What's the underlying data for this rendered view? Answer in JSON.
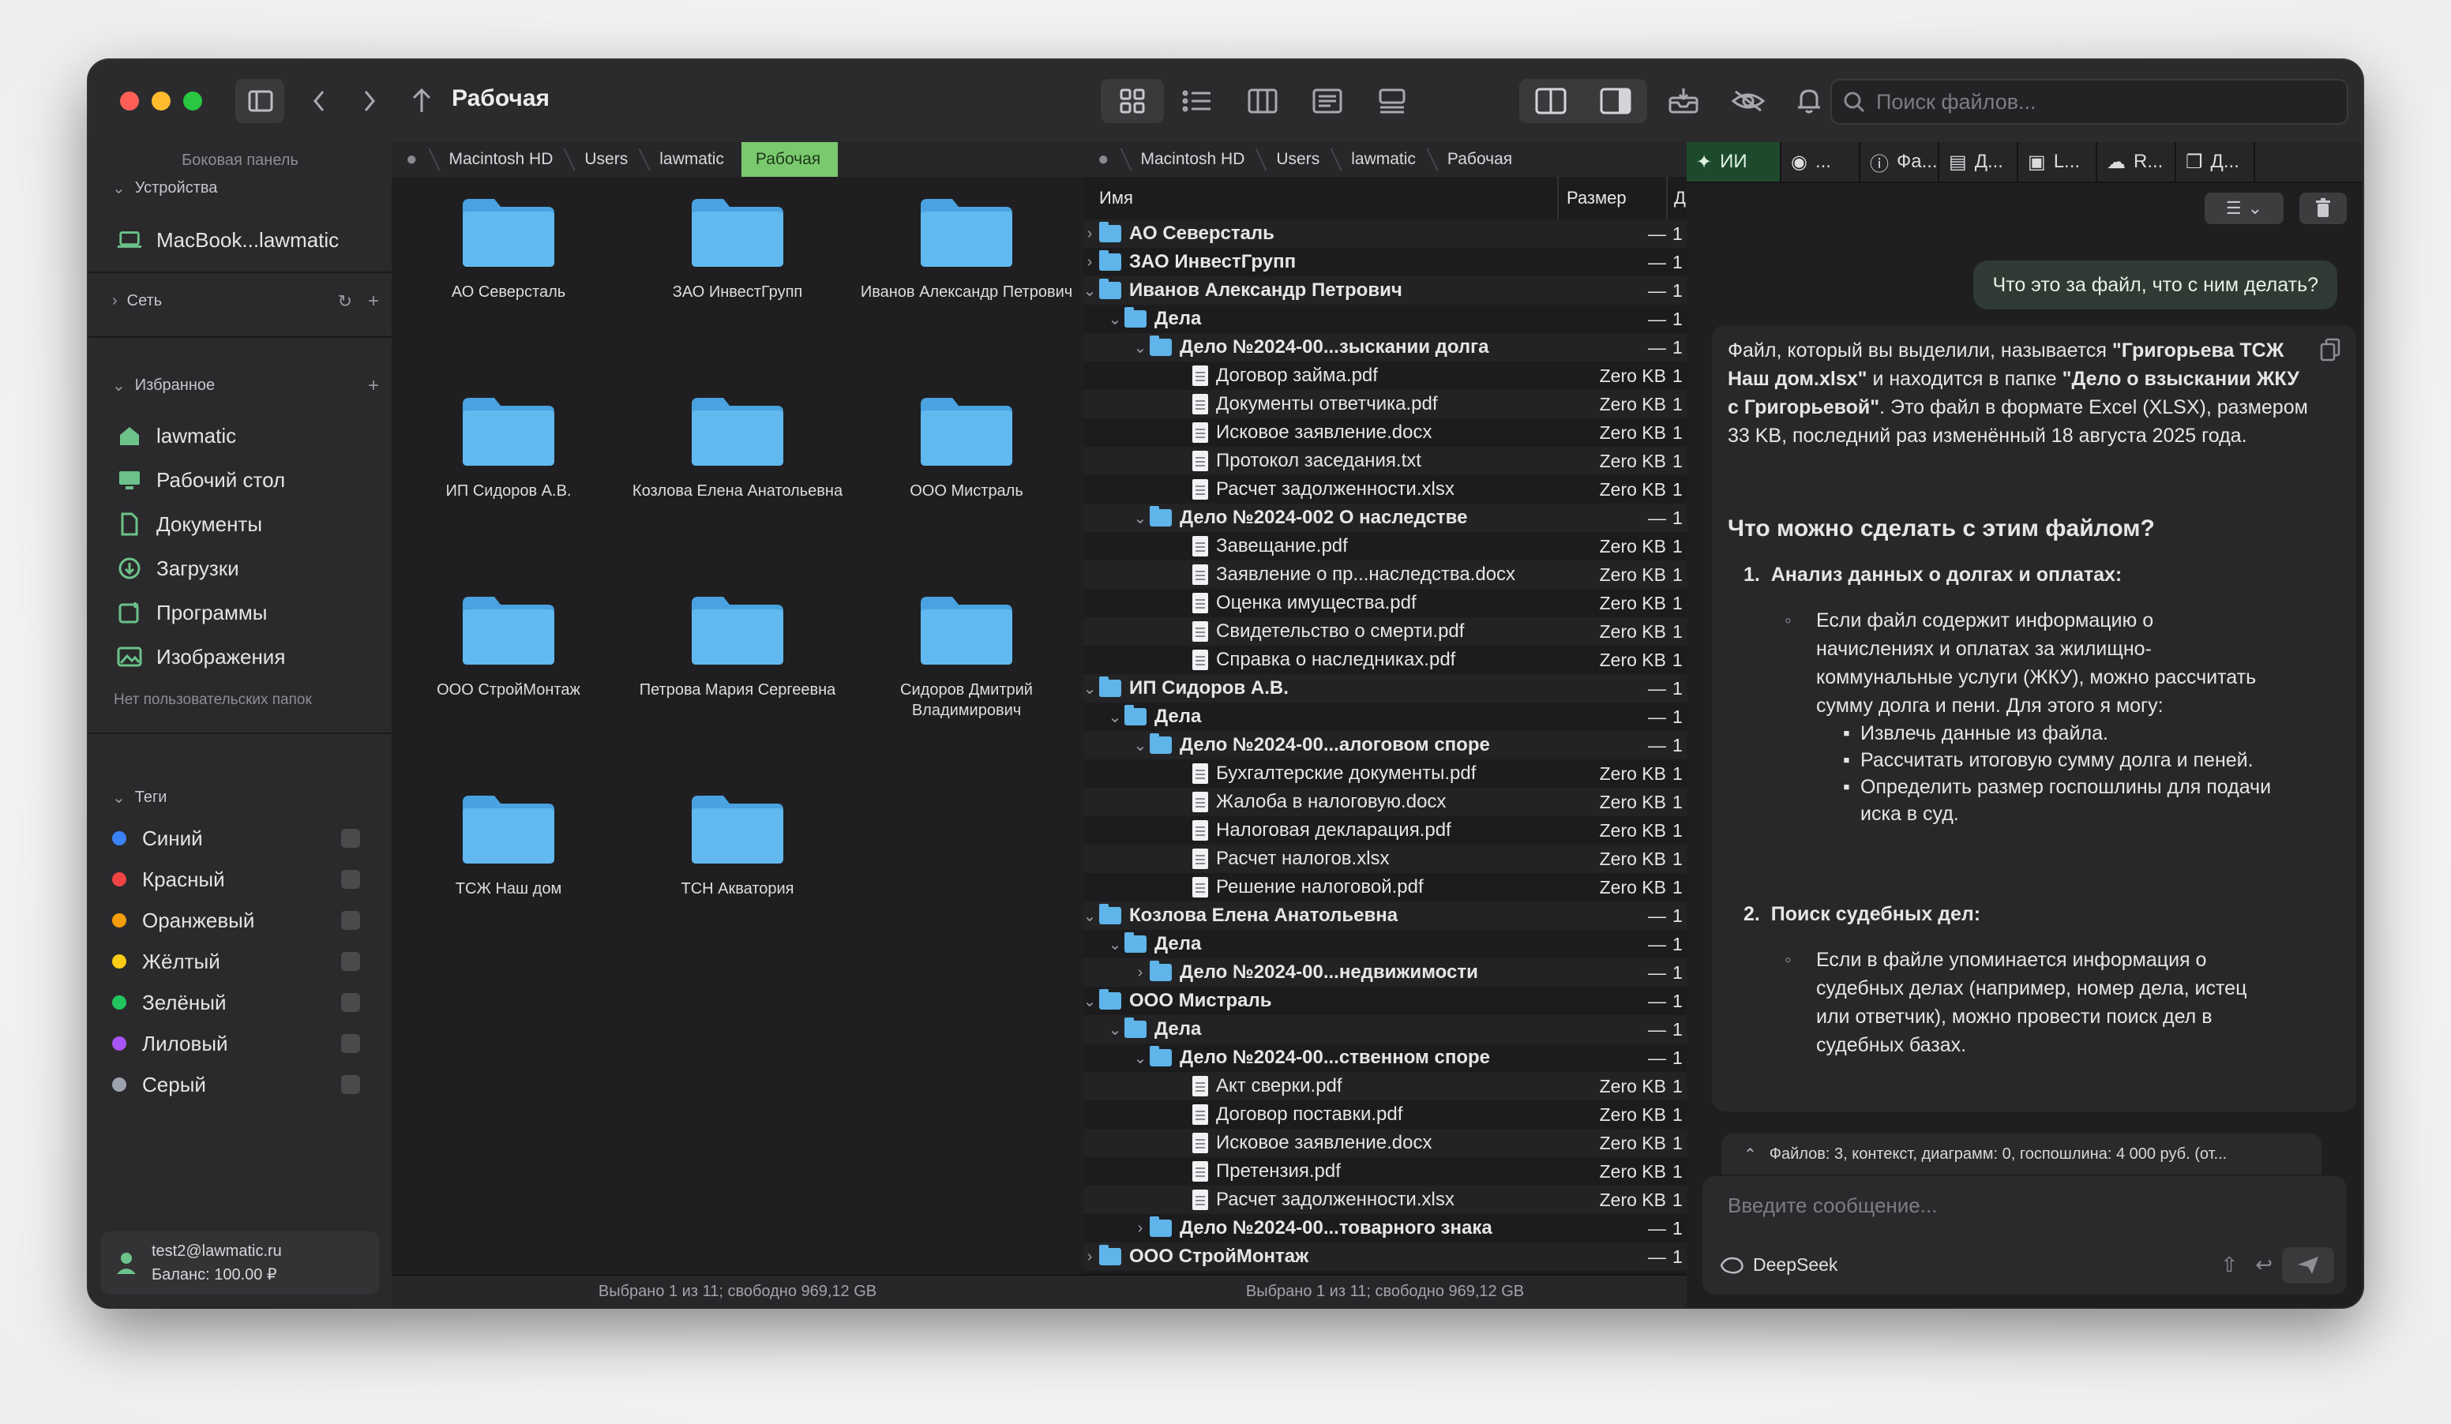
{
  "toolbar": {
    "title": "Рабочая",
    "search_placeholder": "Поиск файлов..."
  },
  "sidebar": {
    "caption": "Боковая панель",
    "devices_label": "Устройства",
    "device_name": "MacBook...lawmatic",
    "network_label": "Сеть",
    "favorites_label": "Избранное",
    "favorites": [
      {
        "label": "lawmatic",
        "icon": "home-icon"
      },
      {
        "label": "Рабочий стол",
        "icon": "desktop-icon"
      },
      {
        "label": "Документы",
        "icon": "document-icon"
      },
      {
        "label": "Загрузки",
        "icon": "download-icon"
      },
      {
        "label": "Программы",
        "icon": "apps-icon"
      },
      {
        "label": "Изображения",
        "icon": "image-icon"
      }
    ],
    "no_custom_folders": "Нет пользовательских папок",
    "tags_label": "Теги",
    "tags": [
      {
        "label": "Синий",
        "color": "#3b82f6"
      },
      {
        "label": "Красный",
        "color": "#ef4444"
      },
      {
        "label": "Оранжевый",
        "color": "#f59e0b"
      },
      {
        "label": "Жёлтый",
        "color": "#facc15"
      },
      {
        "label": "Зелёный",
        "color": "#22c55e"
      },
      {
        "label": "Лиловый",
        "color": "#a855f7"
      },
      {
        "label": "Серый",
        "color": "#9ca3af"
      }
    ],
    "user_email": "test2@lawmatic.ru",
    "user_balance": "Баланс: 100.00 ₽"
  },
  "breadcrumbs": [
    "Macintosh HD",
    "Users",
    "lawmatic",
    "Рабочая"
  ],
  "icon_view": {
    "folders": [
      "АО Северсталь",
      "ЗАО ИнвестГрупп",
      "Иванов Александр Петрович",
      "ИП Сидоров А.В.",
      "Козлова Елена Анатольевна",
      "ООО Мистраль",
      "ООО СтройМонтаж",
      "Петрова Мария Сергеевна",
      "Сидоров Дмитрий Владимирович",
      "ТСЖ Наш дом",
      "ТСН Акватория"
    ],
    "status": "Выбрано 1 из 11; свободно 969,12 GB"
  },
  "list_view": {
    "col_name": "Имя",
    "col_size": "Размер",
    "col_extra": "Д",
    "status": "Выбрано 1 из 11; свободно 969,12 GB",
    "rows": [
      {
        "level": 0,
        "type": "folder",
        "disc": "›",
        "name": "АО Северсталь",
        "size": "—",
        "extra": "1",
        "bold": true
      },
      {
        "level": 0,
        "type": "folder",
        "disc": "›",
        "name": "ЗАО ИнвестГрупп",
        "size": "—",
        "extra": "1",
        "bold": true
      },
      {
        "level": 0,
        "type": "folder",
        "disc": "⌄",
        "name": "Иванов Александр Петрович",
        "size": "—",
        "extra": "1",
        "bold": true
      },
      {
        "level": 1,
        "type": "folder",
        "disc": "⌄",
        "name": "Дела",
        "size": "—",
        "extra": "1",
        "bold": true
      },
      {
        "level": 2,
        "type": "folder",
        "disc": "⌄",
        "name": "Дело №2024-00...зыскании долга",
        "size": "—",
        "extra": "1",
        "bold": true
      },
      {
        "level": 3,
        "type": "file",
        "disc": "",
        "name": "Договор займа.pdf",
        "size": "Zero KB",
        "extra": "1",
        "bold": false
      },
      {
        "level": 3,
        "type": "file",
        "disc": "",
        "name": "Документы ответчика.pdf",
        "size": "Zero KB",
        "extra": "1",
        "bold": false
      },
      {
        "level": 3,
        "type": "file",
        "disc": "",
        "name": "Исковое заявление.docx",
        "size": "Zero KB",
        "extra": "1",
        "bold": false
      },
      {
        "level": 3,
        "type": "file",
        "disc": "",
        "name": "Протокол заседания.txt",
        "size": "Zero KB",
        "extra": "1",
        "bold": false
      },
      {
        "level": 3,
        "type": "file",
        "disc": "",
        "name": "Расчет задолженности.xlsx",
        "size": "Zero KB",
        "extra": "1",
        "bold": false
      },
      {
        "level": 2,
        "type": "folder",
        "disc": "⌄",
        "name": "Дело №2024-002 О наследстве",
        "size": "—",
        "extra": "1",
        "bold": true
      },
      {
        "level": 3,
        "type": "file",
        "disc": "",
        "name": "Завещание.pdf",
        "size": "Zero KB",
        "extra": "1",
        "bold": false
      },
      {
        "level": 3,
        "type": "file",
        "disc": "",
        "name": "Заявление о пр...наследства.docx",
        "size": "Zero KB",
        "extra": "1",
        "bold": false
      },
      {
        "level": 3,
        "type": "file",
        "disc": "",
        "name": "Оценка имущества.pdf",
        "size": "Zero KB",
        "extra": "1",
        "bold": false
      },
      {
        "level": 3,
        "type": "file",
        "disc": "",
        "name": "Свидетельство о смерти.pdf",
        "size": "Zero KB",
        "extra": "1",
        "bold": false
      },
      {
        "level": 3,
        "type": "file",
        "disc": "",
        "name": "Справка о наследниках.pdf",
        "size": "Zero KB",
        "extra": "1",
        "bold": false
      },
      {
        "level": 0,
        "type": "folder",
        "disc": "⌄",
        "name": "ИП Сидоров А.В.",
        "size": "—",
        "extra": "1",
        "bold": true
      },
      {
        "level": 1,
        "type": "folder",
        "disc": "⌄",
        "name": "Дела",
        "size": "—",
        "extra": "1",
        "bold": true
      },
      {
        "level": 2,
        "type": "folder",
        "disc": "⌄",
        "name": "Дело №2024-00...алоговом споре",
        "size": "—",
        "extra": "1",
        "bold": true
      },
      {
        "level": 3,
        "type": "file",
        "disc": "",
        "name": "Бухгалтерские документы.pdf",
        "size": "Zero KB",
        "extra": "1",
        "bold": false
      },
      {
        "level": 3,
        "type": "file",
        "disc": "",
        "name": "Жалоба в налоговую.docx",
        "size": "Zero KB",
        "extra": "1",
        "bold": false
      },
      {
        "level": 3,
        "type": "file",
        "disc": "",
        "name": "Налоговая декларация.pdf",
        "size": "Zero KB",
        "extra": "1",
        "bold": false
      },
      {
        "level": 3,
        "type": "file",
        "disc": "",
        "name": "Расчет налогов.xlsx",
        "size": "Zero KB",
        "extra": "1",
        "bold": false
      },
      {
        "level": 3,
        "type": "file",
        "disc": "",
        "name": "Решение налоговой.pdf",
        "size": "Zero KB",
        "extra": "1",
        "bold": false
      },
      {
        "level": 0,
        "type": "folder",
        "disc": "⌄",
        "name": "Козлова Елена Анатольевна",
        "size": "—",
        "extra": "1",
        "bold": true
      },
      {
        "level": 1,
        "type": "folder",
        "disc": "⌄",
        "name": "Дела",
        "size": "—",
        "extra": "1",
        "bold": true
      },
      {
        "level": 2,
        "type": "folder",
        "disc": "›",
        "name": "Дело №2024-00...недвижимости",
        "size": "—",
        "extra": "1",
        "bold": true
      },
      {
        "level": 0,
        "type": "folder",
        "disc": "⌄",
        "name": "ООО Мистраль",
        "size": "—",
        "extra": "1",
        "bold": true
      },
      {
        "level": 1,
        "type": "folder",
        "disc": "⌄",
        "name": "Дела",
        "size": "—",
        "extra": "1",
        "bold": true
      },
      {
        "level": 2,
        "type": "folder",
        "disc": "⌄",
        "name": "Дело №2024-00...ственном споре",
        "size": "—",
        "extra": "1",
        "bold": true
      },
      {
        "level": 3,
        "type": "file",
        "disc": "",
        "name": "Акт сверки.pdf",
        "size": "Zero KB",
        "extra": "1",
        "bold": false
      },
      {
        "level": 3,
        "type": "file",
        "disc": "",
        "name": "Договор поставки.pdf",
        "size": "Zero KB",
        "extra": "1",
        "bold": false
      },
      {
        "level": 3,
        "type": "file",
        "disc": "",
        "name": "Исковое заявление.docx",
        "size": "Zero KB",
        "extra": "1",
        "bold": false
      },
      {
        "level": 3,
        "type": "file",
        "disc": "",
        "name": "Претензия.pdf",
        "size": "Zero KB",
        "extra": "1",
        "bold": false
      },
      {
        "level": 3,
        "type": "file",
        "disc": "",
        "name": "Расчет задолженности.xlsx",
        "size": "Zero KB",
        "extra": "1",
        "bold": false
      },
      {
        "level": 2,
        "type": "folder",
        "disc": "›",
        "name": "Дело №2024-00...товарного знака",
        "size": "—",
        "extra": "1",
        "bold": true
      },
      {
        "level": 0,
        "type": "folder",
        "disc": "›",
        "name": "ООО СтройМонтаж",
        "size": "—",
        "extra": "1",
        "bold": true
      }
    ]
  },
  "ai_panel": {
    "tabs": [
      {
        "label": "ИИ",
        "icon": "magic-wand-icon"
      },
      {
        "label": "...",
        "icon": "eye-icon"
      },
      {
        "label": "Фа...",
        "icon": "info-icon"
      },
      {
        "label": "Д...",
        "icon": "doc-icon"
      },
      {
        "label": "L...",
        "icon": "card-icon"
      },
      {
        "label": "R...",
        "icon": "brain-icon"
      },
      {
        "label": "Д...",
        "icon": "copy-doc-icon"
      }
    ],
    "user_message": "Что это за файл, что с ним делать?",
    "answer": {
      "intro_1": "Файл, который вы выделили, называется ",
      "intro_file": "\"Григорьева ТСЖ Наш дом.xlsx\"",
      "intro_2": " и находится в папке ",
      "intro_folder": "\"Дело о взыскании ЖКУ с Григорьевой\"",
      "intro_3": ". Это файл в формате Excel (XLSX), размером 33 KB, последний раз изменённый 18 августа 2025 года.",
      "heading": "Что можно сделать с этим файлом?",
      "item1_title": "Анализ данных о долгах и оплатах:",
      "item1_text": "Если файл содержит информацию о начислениях и оплатах за жилищно-коммунальные услуги (ЖКУ), можно рассчитать сумму долга и пени. Для этого я могу:",
      "item1_bullets": [
        "Извлечь данные из файла.",
        "Рассчитать итоговую сумму долга и пеней.",
        "Определить размер госпошлины для подачи иска в суд."
      ],
      "item2_title": "Поиск судебных дел:",
      "item2_text": "Если в файле упоминается информация о судебных делах (например, номер дела, истец или ответчик), можно провести поиск дел в судебных базах."
    },
    "context_bar": "Файлов: 3, контекст, диаграмм: 0, госпошлина: 4 000 руб. (от...",
    "input_placeholder": "Введите сообщение...",
    "model_name": "DeepSeek"
  }
}
